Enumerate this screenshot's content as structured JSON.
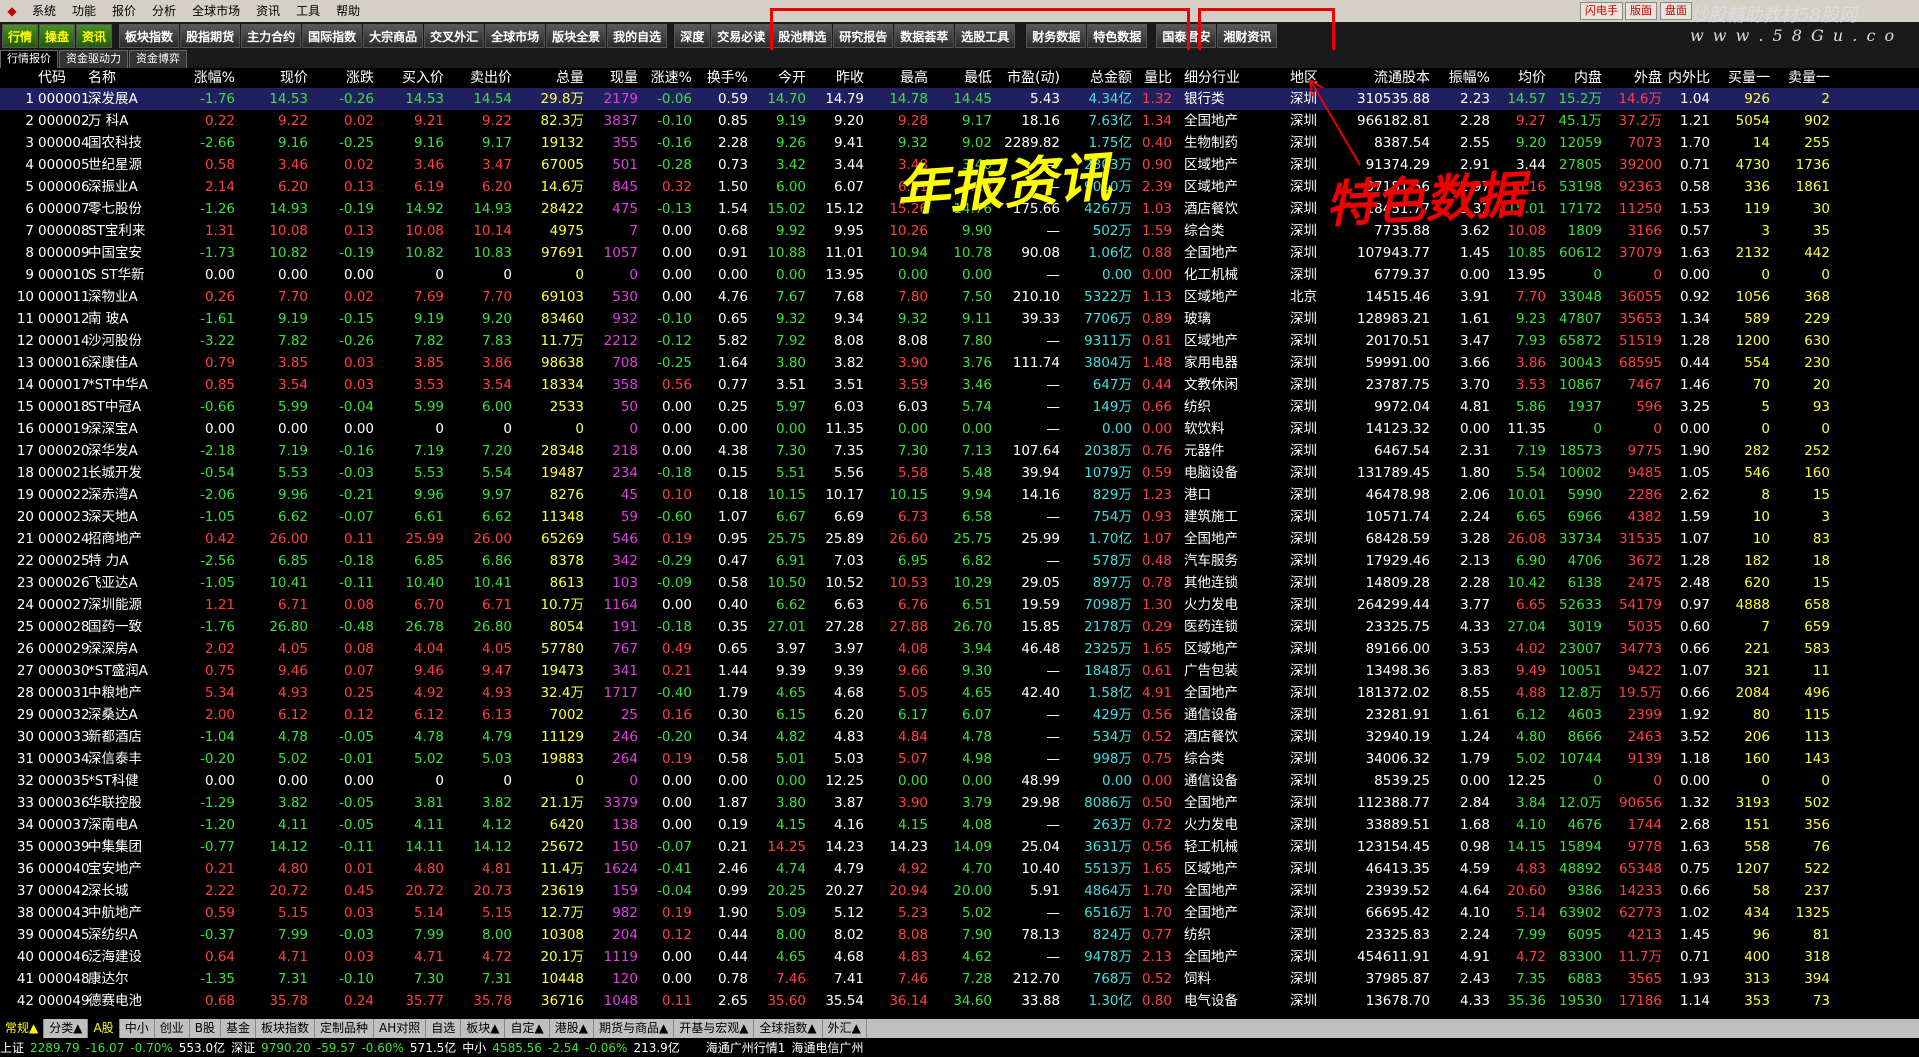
{
  "menu": {
    "items": [
      "系统",
      "功能",
      "报价",
      "分析",
      "全球市场",
      "资讯",
      "工具",
      "帮助"
    ],
    "title": "",
    "right_buttons": [
      "闪电手",
      "版面",
      "盘面"
    ]
  },
  "toolbar": {
    "left_tabs": [
      "行情",
      "操盘",
      "资讯"
    ],
    "tabs": [
      "板块指数",
      "股指期货",
      "主力合约",
      "国际指数",
      "大宗商品",
      "交叉外汇",
      "全球市场",
      "版块全景",
      "我的自选"
    ],
    "red_group_1": [
      "深度",
      "交易必读",
      "股池精选",
      "研究报告",
      "数据荟萃",
      "选股工具"
    ],
    "red_group_2": [
      "财务数据",
      "特色数据"
    ],
    "more_tabs": [
      "国泰君安",
      "湘财资讯"
    ]
  },
  "watermark": {
    "cn": "炒股輔助教材58股网",
    "en": "w w w . 5 8 G u . c o m"
  },
  "subtabs": [
    "行情报价",
    "资金驱动力",
    "资金博弈"
  ],
  "annotations": {
    "left": "年报资讯",
    "right": "特色数据"
  },
  "columns": [
    "",
    "代码",
    "名称",
    "涨幅%",
    "现价",
    "涨跌",
    "买入价",
    "卖出价",
    "总量",
    "现量",
    "涨速%",
    "换手%",
    "今开",
    "昨收",
    "最高",
    "最低",
    "市盈(动)",
    "总金额",
    "量比",
    "细分行业",
    "地区",
    "流通股本",
    "振幅%",
    "均价",
    "内盘",
    "外盘",
    "内外比",
    "买量一",
    "卖量一"
  ],
  "rows": [
    [
      "1",
      "000001",
      "深发展A",
      "-1.76",
      "14.53",
      "-0.26",
      "14.53",
      "14.54",
      "29.8万",
      "2179",
      "-0.06",
      "0.59",
      "14.70",
      "14.79",
      "14.78",
      "14.45",
      "5.43",
      "4.34亿",
      "1.32",
      "银行类",
      "深圳",
      "310535.88",
      "2.23",
      "14.57",
      "15.2万",
      "14.6万",
      "1.04",
      "926",
      "2"
    ],
    [
      "2",
      "000002",
      "万  科A",
      "0.22",
      "9.22",
      "0.02",
      "9.21",
      "9.22",
      "82.3万",
      "3837",
      "-0.10",
      "0.85",
      "9.19",
      "9.20",
      "9.28",
      "9.17",
      "18.16",
      "7.63亿",
      "1.34",
      "全国地产",
      "深圳",
      "966182.81",
      "2.28",
      "9.27",
      "45.1万",
      "37.2万",
      "1.21",
      "5054",
      "902"
    ],
    [
      "3",
      "000004",
      "国农科技",
      "-2.66",
      "9.16",
      "-0.25",
      "9.16",
      "9.17",
      "19132",
      "355",
      "-0.16",
      "2.28",
      "9.26",
      "9.41",
      "9.32",
      "9.02",
      "2289.82",
      "1.75亿",
      "0.40",
      "生物制药",
      "深圳",
      "8387.54",
      "2.55",
      "9.20",
      "12059",
      "7073",
      "1.70",
      "14",
      "255"
    ],
    [
      "4",
      "000005",
      "世纪星源",
      "0.58",
      "3.46",
      "0.02",
      "3.46",
      "3.47",
      "67005",
      "501",
      "-0.28",
      "0.73",
      "3.42",
      "3.44",
      "3.48",
      "3.40",
      "—",
      "2303万",
      "0.90",
      "区域地产",
      "深圳",
      "91374.29",
      "2.91",
      "3.44",
      "27805",
      "39200",
      "0.71",
      "4730",
      "1736"
    ],
    [
      "5",
      "000006",
      "深振业A",
      "2.14",
      "6.20",
      "0.13",
      "6.19",
      "6.20",
      "14.6万",
      "845",
      "0.32",
      "1.50",
      "6.00",
      "6.07",
      "6.31",
      "6.13",
      "—",
      "9010万",
      "2.39",
      "区域地产",
      "深圳",
      "97181.56",
      "2.97",
      "6.16",
      "53198",
      "92363",
      "0.58",
      "336",
      "1861"
    ],
    [
      "6",
      "000007",
      "零七股份",
      "-1.26",
      "14.93",
      "-0.19",
      "14.92",
      "14.93",
      "28422",
      "475",
      "-0.13",
      "1.54",
      "15.02",
      "15.12",
      "15.26",
      "14.76",
      "175.66",
      "4267万",
      "1.03",
      "酒店餐饮",
      "深圳",
      "18451.77",
      "3.31",
      "15.01",
      "17172",
      "11250",
      "1.53",
      "119",
      "30"
    ],
    [
      "7",
      "000008",
      "ST宝利来",
      "1.31",
      "10.08",
      "0.13",
      "10.08",
      "10.14",
      "4975",
      "7",
      "0.00",
      "0.68",
      "9.92",
      "9.95",
      "10.26",
      "9.90",
      "—",
      "502万",
      "1.59",
      "综合类",
      "深圳",
      "7735.88",
      "3.62",
      "10.08",
      "1809",
      "3166",
      "0.57",
      "3",
      "35"
    ],
    [
      "8",
      "000009",
      "中国宝安",
      "-1.73",
      "10.82",
      "-0.19",
      "10.82",
      "10.83",
      "97691",
      "1057",
      "0.00",
      "0.91",
      "10.88",
      "11.01",
      "10.94",
      "10.78",
      "90.08",
      "1.06亿",
      "0.88",
      "全国地产",
      "深圳",
      "107943.77",
      "1.45",
      "10.85",
      "60612",
      "37079",
      "1.63",
      "2132",
      "442"
    ],
    [
      "9",
      "000010",
      "S ST华新",
      "0.00",
      "0.00",
      "0.00",
      "0",
      "0",
      "0",
      "0",
      "0.00",
      "0.00",
      "0.00",
      "13.95",
      "0.00",
      "0.00",
      "—",
      "0.00",
      "0.00",
      "化工机械",
      "深圳",
      "6779.37",
      "0.00",
      "13.95",
      "0",
      "0",
      "0.00",
      "0",
      "0"
    ],
    [
      "10",
      "000011",
      "深物业A",
      "0.26",
      "7.70",
      "0.02",
      "7.69",
      "7.70",
      "69103",
      "530",
      "0.00",
      "4.76",
      "7.67",
      "7.68",
      "7.80",
      "7.50",
      "210.10",
      "5322万",
      "1.13",
      "区域地产",
      "北京",
      "14515.46",
      "3.91",
      "7.70",
      "33048",
      "36055",
      "0.92",
      "1056",
      "368"
    ],
    [
      "11",
      "000012",
      "南  玻A",
      "-1.61",
      "9.19",
      "-0.15",
      "9.19",
      "9.20",
      "83460",
      "932",
      "-0.10",
      "0.65",
      "9.32",
      "9.34",
      "9.32",
      "9.11",
      "39.33",
      "7706万",
      "0.89",
      "玻璃",
      "深圳",
      "128983.21",
      "1.61",
      "9.23",
      "47807",
      "35653",
      "1.34",
      "589",
      "229"
    ],
    [
      "12",
      "000014",
      "沙河股份",
      "-3.22",
      "7.82",
      "-0.26",
      "7.82",
      "7.83",
      "11.7万",
      "2212",
      "-0.12",
      "5.82",
      "7.92",
      "8.08",
      "8.08",
      "7.80",
      "—",
      "9311万",
      "0.81",
      "区域地产",
      "深圳",
      "20170.51",
      "3.47",
      "7.93",
      "65872",
      "51519",
      "1.28",
      "1200",
      "630"
    ],
    [
      "13",
      "000016",
      "深康佳A",
      "0.79",
      "3.85",
      "0.03",
      "3.85",
      "3.86",
      "98638",
      "708",
      "-0.25",
      "1.64",
      "3.80",
      "3.82",
      "3.90",
      "3.76",
      "111.74",
      "3804万",
      "1.48",
      "家用电器",
      "深圳",
      "59991.00",
      "3.66",
      "3.86",
      "30043",
      "68595",
      "0.44",
      "554",
      "230"
    ],
    [
      "14",
      "000017",
      "*ST中华A",
      "0.85",
      "3.54",
      "0.03",
      "3.53",
      "3.54",
      "18334",
      "358",
      "0.56",
      "0.77",
      "3.51",
      "3.51",
      "3.59",
      "3.46",
      "—",
      "647万",
      "0.44",
      "文教休闲",
      "深圳",
      "23787.75",
      "3.70",
      "3.53",
      "10867",
      "7467",
      "1.46",
      "70",
      "20"
    ],
    [
      "15",
      "000018",
      "ST中冠A",
      "-0.66",
      "5.99",
      "-0.04",
      "5.99",
      "6.00",
      "2533",
      "50",
      "0.00",
      "0.25",
      "5.97",
      "6.03",
      "6.03",
      "5.74",
      "—",
      "149万",
      "0.66",
      "纺织",
      "深圳",
      "9972.04",
      "4.81",
      "5.86",
      "1937",
      "596",
      "3.25",
      "5",
      "93"
    ],
    [
      "16",
      "000019",
      "深深宝A",
      "0.00",
      "0.00",
      "0.00",
      "0",
      "0",
      "0",
      "0",
      "0.00",
      "0.00",
      "0.00",
      "11.35",
      "0.00",
      "0.00",
      "—",
      "0.00",
      "0.00",
      "软饮料",
      "深圳",
      "14123.32",
      "0.00",
      "11.35",
      "0",
      "0",
      "0.00",
      "0",
      "0"
    ],
    [
      "17",
      "000020",
      "深华发A",
      "-2.18",
      "7.19",
      "-0.16",
      "7.19",
      "7.20",
      "28348",
      "218",
      "0.00",
      "4.38",
      "7.30",
      "7.35",
      "7.30",
      "7.13",
      "107.64",
      "2038万",
      "0.76",
      "元器件",
      "深圳",
      "6467.54",
      "2.31",
      "7.19",
      "18573",
      "9775",
      "1.90",
      "282",
      "252"
    ],
    [
      "18",
      "000021",
      "长城开发",
      "-0.54",
      "5.53",
      "-0.03",
      "5.53",
      "5.54",
      "19487",
      "234",
      "-0.18",
      "0.15",
      "5.51",
      "5.56",
      "5.58",
      "5.48",
      "39.94",
      "1079万",
      "0.59",
      "电脑设备",
      "深圳",
      "131789.45",
      "1.80",
      "5.54",
      "10002",
      "9485",
      "1.05",
      "546",
      "160"
    ],
    [
      "19",
      "000022",
      "深赤湾A",
      "-2.06",
      "9.96",
      "-0.21",
      "9.96",
      "9.97",
      "8276",
      "45",
      "0.10",
      "0.18",
      "10.15",
      "10.17",
      "10.15",
      "9.94",
      "14.16",
      "829万",
      "1.23",
      "港口",
      "深圳",
      "46478.98",
      "2.06",
      "10.01",
      "5990",
      "2286",
      "2.62",
      "8",
      "15"
    ],
    [
      "20",
      "000023",
      "深天地A",
      "-1.05",
      "6.62",
      "-0.07",
      "6.61",
      "6.62",
      "11348",
      "59",
      "-0.60",
      "1.07",
      "6.67",
      "6.69",
      "6.73",
      "6.58",
      "—",
      "754万",
      "0.93",
      "建筑施工",
      "深圳",
      "10571.74",
      "2.24",
      "6.65",
      "6966",
      "4382",
      "1.59",
      "10",
      "3"
    ],
    [
      "21",
      "000024",
      "招商地产",
      "0.42",
      "26.00",
      "0.11",
      "25.99",
      "26.00",
      "65269",
      "546",
      "0.19",
      "0.95",
      "25.75",
      "25.89",
      "26.60",
      "25.75",
      "25.99",
      "1.70亿",
      "1.07",
      "全国地产",
      "深圳",
      "68428.59",
      "3.28",
      "26.08",
      "33734",
      "31535",
      "1.07",
      "10",
      "83"
    ],
    [
      "22",
      "000025",
      "特  力A",
      "-2.56",
      "6.85",
      "-0.18",
      "6.85",
      "6.86",
      "8378",
      "342",
      "-0.29",
      "0.47",
      "6.91",
      "7.03",
      "6.95",
      "6.82",
      "—",
      "578万",
      "0.48",
      "汽车服务",
      "深圳",
      "17929.46",
      "2.13",
      "6.90",
      "4706",
      "3672",
      "1.28",
      "182",
      "18"
    ],
    [
      "23",
      "000026",
      "飞亚达A",
      "-1.05",
      "10.41",
      "-0.11",
      "10.40",
      "10.41",
      "8613",
      "103",
      "-0.09",
      "0.58",
      "10.50",
      "10.52",
      "10.53",
      "10.29",
      "29.05",
      "897万",
      "0.78",
      "其他连锁",
      "深圳",
      "14809.28",
      "2.28",
      "10.42",
      "6138",
      "2475",
      "2.48",
      "620",
      "15"
    ],
    [
      "24",
      "000027",
      "深圳能源",
      "1.21",
      "6.71",
      "0.08",
      "6.70",
      "6.71",
      "10.7万",
      "1164",
      "0.00",
      "0.40",
      "6.62",
      "6.63",
      "6.76",
      "6.51",
      "19.59",
      "7098万",
      "1.30",
      "火力发电",
      "深圳",
      "264299.44",
      "3.77",
      "6.65",
      "52633",
      "54179",
      "0.97",
      "4888",
      "658"
    ],
    [
      "25",
      "000028",
      "国药一致",
      "-1.76",
      "26.80",
      "-0.48",
      "26.78",
      "26.80",
      "8054",
      "191",
      "-0.18",
      "0.35",
      "27.01",
      "27.28",
      "27.88",
      "26.70",
      "15.85",
      "2178万",
      "0.29",
      "医药连锁",
      "深圳",
      "23325.75",
      "4.33",
      "27.04",
      "3019",
      "5035",
      "0.60",
      "7",
      "659"
    ],
    [
      "26",
      "000029",
      "深深房A",
      "2.02",
      "4.05",
      "0.08",
      "4.04",
      "4.05",
      "57780",
      "767",
      "0.49",
      "0.65",
      "3.97",
      "3.97",
      "4.08",
      "3.94",
      "46.48",
      "2325万",
      "1.65",
      "区域地产",
      "深圳",
      "89166.00",
      "3.53",
      "4.02",
      "23007",
      "34773",
      "0.66",
      "221",
      "583"
    ],
    [
      "27",
      "000030",
      "*ST盛润A",
      "0.75",
      "9.46",
      "0.07",
      "9.46",
      "9.47",
      "19473",
      "341",
      "0.21",
      "1.44",
      "9.39",
      "9.39",
      "9.66",
      "9.30",
      "—",
      "1848万",
      "0.61",
      "广告包装",
      "深圳",
      "13498.36",
      "3.83",
      "9.49",
      "10051",
      "9422",
      "1.07",
      "321",
      "11"
    ],
    [
      "28",
      "000031",
      "中粮地产",
      "5.34",
      "4.93",
      "0.25",
      "4.92",
      "4.93",
      "32.4万",
      "1717",
      "-0.40",
      "1.79",
      "4.65",
      "4.68",
      "5.05",
      "4.65",
      "42.40",
      "1.58亿",
      "4.91",
      "全国地产",
      "深圳",
      "181372.02",
      "8.55",
      "4.88",
      "12.8万",
      "19.5万",
      "0.66",
      "2084",
      "496"
    ],
    [
      "29",
      "000032",
      "深桑达A",
      "2.00",
      "6.12",
      "0.12",
      "6.12",
      "6.13",
      "7002",
      "25",
      "0.16",
      "0.30",
      "6.15",
      "6.20",
      "6.17",
      "6.07",
      "—",
      "429万",
      "0.56",
      "通信设备",
      "深圳",
      "23281.91",
      "1.61",
      "6.12",
      "4603",
      "2399",
      "1.92",
      "80",
      "115"
    ],
    [
      "30",
      "000033",
      "新都酒店",
      "-1.04",
      "4.78",
      "-0.05",
      "4.78",
      "4.79",
      "11129",
      "246",
      "-0.20",
      "0.34",
      "4.82",
      "4.83",
      "4.84",
      "4.78",
      "—",
      "534万",
      "0.52",
      "酒店餐饮",
      "深圳",
      "32940.19",
      "1.24",
      "4.80",
      "8666",
      "2463",
      "3.52",
      "206",
      "113"
    ],
    [
      "31",
      "000034",
      "深信泰丰",
      "-0.20",
      "5.02",
      "-0.01",
      "5.02",
      "5.03",
      "19883",
      "264",
      "0.19",
      "0.58",
      "5.01",
      "5.03",
      "5.07",
      "4.98",
      "—",
      "998万",
      "0.75",
      "综合类",
      "深圳",
      "34006.32",
      "1.79",
      "5.02",
      "10744",
      "9139",
      "1.18",
      "160",
      "143"
    ],
    [
      "32",
      "000035",
      "*ST科健",
      "0.00",
      "0.00",
      "0.00",
      "0",
      "0",
      "0",
      "0",
      "0.00",
      "0.00",
      "0.00",
      "12.25",
      "0.00",
      "0.00",
      "48.99",
      "0.00",
      "0.00",
      "通信设备",
      "深圳",
      "8539.25",
      "0.00",
      "12.25",
      "0",
      "0",
      "0.00",
      "0",
      "0"
    ],
    [
      "33",
      "000036",
      "华联控股",
      "-1.29",
      "3.82",
      "-0.05",
      "3.81",
      "3.82",
      "21.1万",
      "3379",
      "0.00",
      "1.87",
      "3.80",
      "3.87",
      "3.90",
      "3.79",
      "29.98",
      "8086万",
      "0.50",
      "全国地产",
      "深圳",
      "112388.77",
      "2.84",
      "3.84",
      "12.0万",
      "90656",
      "1.32",
      "3193",
      "502"
    ],
    [
      "34",
      "000037",
      "深南电A",
      "-1.20",
      "4.11",
      "-0.05",
      "4.11",
      "4.12",
      "6420",
      "138",
      "0.00",
      "0.19",
      "4.15",
      "4.16",
      "4.15",
      "4.08",
      "—",
      "263万",
      "0.72",
      "火力发电",
      "深圳",
      "33889.51",
      "1.68",
      "4.10",
      "4676",
      "1744",
      "2.68",
      "151",
      "356"
    ],
    [
      "35",
      "000039",
      "中集集团",
      "-0.77",
      "14.12",
      "-0.11",
      "14.11",
      "14.12",
      "25672",
      "150",
      "-0.07",
      "0.21",
      "14.25",
      "14.23",
      "14.23",
      "14.09",
      "25.04",
      "3631万",
      "0.56",
      "轻工机械",
      "深圳",
      "123154.45",
      "0.98",
      "14.15",
      "15894",
      "9778",
      "1.63",
      "558",
      "76"
    ],
    [
      "36",
      "000040",
      "宝安地产",
      "0.21",
      "4.80",
      "0.01",
      "4.80",
      "4.81",
      "11.4万",
      "1624",
      "-0.41",
      "2.46",
      "4.74",
      "4.79",
      "4.92",
      "4.70",
      "10.40",
      "5513万",
      "1.65",
      "区域地产",
      "深圳",
      "46413.35",
      "4.59",
      "4.83",
      "48892",
      "65348",
      "0.75",
      "1207",
      "522"
    ],
    [
      "37",
      "000042",
      "深长城",
      "2.22",
      "20.72",
      "0.45",
      "20.72",
      "20.73",
      "23619",
      "159",
      "-0.04",
      "0.99",
      "20.25",
      "20.27",
      "20.94",
      "20.00",
      "5.91",
      "4864万",
      "1.70",
      "全国地产",
      "深圳",
      "23939.52",
      "4.64",
      "20.60",
      "9386",
      "14233",
      "0.66",
      "58",
      "237"
    ],
    [
      "38",
      "000043",
      "中航地产",
      "0.59",
      "5.15",
      "0.03",
      "5.14",
      "5.15",
      "12.7万",
      "982",
      "0.19",
      "1.90",
      "5.09",
      "5.12",
      "5.23",
      "5.02",
      "—",
      "6516万",
      "1.70",
      "全国地产",
      "深圳",
      "66695.42",
      "4.10",
      "5.14",
      "63902",
      "62773",
      "1.02",
      "434",
      "1325"
    ],
    [
      "39",
      "000045",
      "深纺织A",
      "-0.37",
      "7.99",
      "-0.03",
      "7.99",
      "8.00",
      "10308",
      "204",
      "0.12",
      "0.44",
      "8.00",
      "8.02",
      "8.08",
      "7.90",
      "78.13",
      "824万",
      "0.77",
      "纺织",
      "深圳",
      "23325.83",
      "2.24",
      "7.99",
      "6095",
      "4213",
      "1.45",
      "96",
      "81"
    ],
    [
      "40",
      "000046",
      "泛海建设",
      "0.64",
      "4.71",
      "0.03",
      "4.71",
      "4.72",
      "20.1万",
      "1119",
      "0.00",
      "0.44",
      "4.65",
      "4.68",
      "4.83",
      "4.62",
      "—",
      "9478万",
      "2.13",
      "全国地产",
      "深圳",
      "454611.91",
      "4.91",
      "4.72",
      "83300",
      "11.7万",
      "0.71",
      "400",
      "318"
    ],
    [
      "41",
      "000048",
      "康达尔",
      "-1.35",
      "7.31",
      "-0.10",
      "7.30",
      "7.31",
      "10448",
      "120",
      "0.00",
      "0.78",
      "7.46",
      "7.41",
      "7.46",
      "7.28",
      "212.70",
      "768万",
      "0.52",
      "饲料",
      "深圳",
      "37985.87",
      "2.43",
      "7.35",
      "6883",
      "3565",
      "1.93",
      "313",
      "394"
    ],
    [
      "42",
      "000049",
      "德赛电池",
      "0.68",
      "35.78",
      "0.24",
      "35.77",
      "35.78",
      "36716",
      "1048",
      "0.11",
      "2.65",
      "35.60",
      "35.54",
      "36.14",
      "34.60",
      "33.88",
      "1.30亿",
      "0.80",
      "电气设备",
      "深圳",
      "13678.70",
      "4.33",
      "35.36",
      "19530",
      "17186",
      "1.14",
      "353",
      "73"
    ]
  ],
  "bottom_tabs": [
    "常规▲",
    "分类▲",
    "A股",
    "中小",
    "创业",
    "B股",
    "基金",
    "板块指数",
    "定制品种",
    "AH对照",
    "自选",
    "板块▲",
    "自定▲",
    "港股▲",
    "期货与商品▲",
    "开基与宏观▲",
    "全球指数▲",
    "外汇▲"
  ],
  "status": {
    "sh_label": "上证",
    "sh_value": "2289.79",
    "sh_change": "-16.07",
    "sh_pct": "-0.70%",
    "sh_amount": "553.0亿",
    "sz_label": "深证",
    "sz_value": "9790.20",
    "sz_change": "-59.57",
    "sz_pct": "-0.60%",
    "sz_amount": "571.5亿",
    "zx_label": "中小",
    "zx_value": "4585.56",
    "zx_change": "-2.54",
    "zx_pct": "-0.06%",
    "zx_amount": "213.9亿",
    "server1": "海通广州行情1",
    "server2": "海通电信广州"
  }
}
